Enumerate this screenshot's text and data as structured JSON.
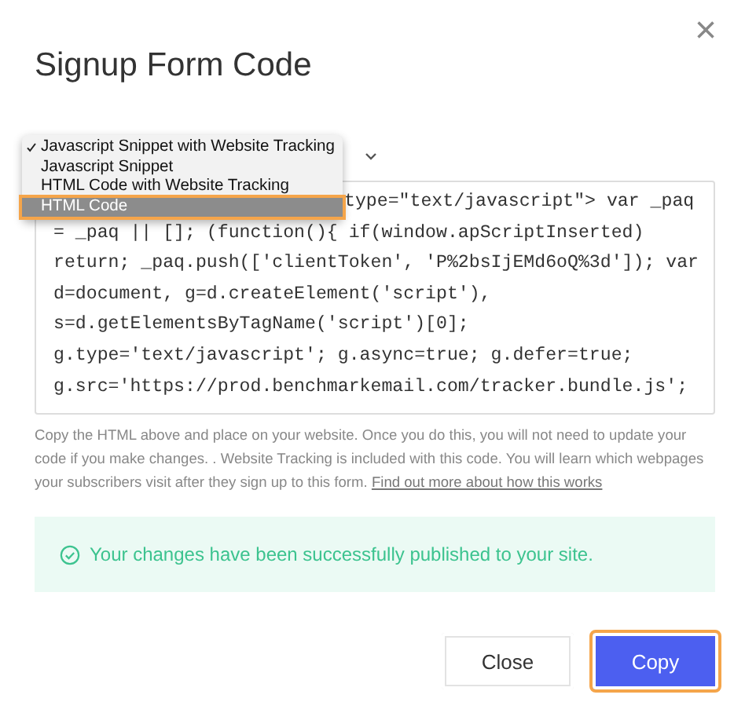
{
  "dialog": {
    "title": "Signup Form Code",
    "close": "×"
  },
  "format_menu": {
    "items": [
      {
        "label": "Javascript Snippet with Website Tracking",
        "checked": true,
        "selected": false
      },
      {
        "label": "Javascript Snippet",
        "checked": false,
        "selected": false
      },
      {
        "label": "HTML Code with Website Tracking",
        "checked": false,
        "selected": false
      },
      {
        "label": "HTML Code",
        "checked": false,
        "selected": true
      }
    ]
  },
  "code_lines": [
    "type=\"text/javascript\"> var _paq",
    "= _paq || []; (function(){ if(window.apScriptInserted)",
    "return; _paq.push(['clientToken', 'P%2bsIjEMd6oQ%3d']); var",
    "d=document, g=d.createElement('script'),",
    "s=d.getElementsByTagName('script')[0];",
    "g.type='text/javascript'; g.async=true; g.defer=true;",
    "g.src='https://prod.benchmarkemail.com/tracker.bundle.js';"
  ],
  "description": "Copy the HTML above and place on your website. Once you do this, you will not need to update your code if you make changes. . Website Tracking is included with this code. You will learn which webpages your subscribers visit after they sign up to this form.",
  "learn_more_link": "Find out more about how this works",
  "success_message": "Your changes have been successfully published to your site.",
  "buttons": [
    {
      "label": "Close",
      "kind": "secondary",
      "focused": false
    },
    {
      "label": "Copy",
      "kind": "primary",
      "focused": true
    }
  ]
}
